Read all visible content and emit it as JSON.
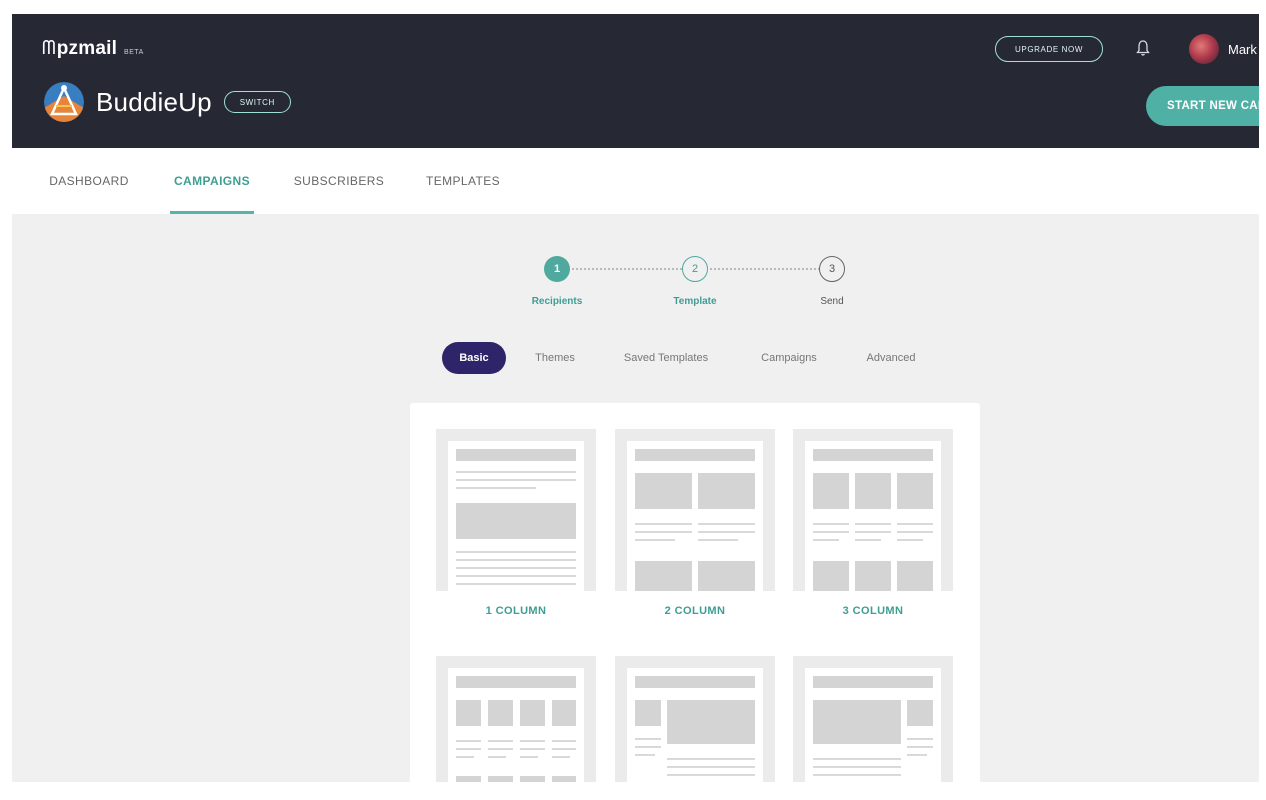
{
  "header": {
    "logo_text": "pzmail",
    "beta_label": "BETA",
    "upgrade_label": "UPGRADE NOW",
    "user_name": "Mark",
    "account_name": "BuddieUp",
    "switch_label": "SWITCH",
    "start_label": "START NEW CAMPAIGN"
  },
  "nav": {
    "items": [
      "DASHBOARD",
      "CAMPAIGNS",
      "SUBSCRIBERS",
      "TEMPLATES"
    ],
    "active": "CAMPAIGNS"
  },
  "stepper": {
    "steps": [
      {
        "number": "1",
        "label": "Recipients",
        "state": "complete"
      },
      {
        "number": "2",
        "label": "Template",
        "state": "current"
      },
      {
        "number": "3",
        "label": "Send",
        "state": "upcoming"
      }
    ]
  },
  "template_tabs": {
    "items": [
      "Basic",
      "Themes",
      "Saved Templates",
      "Campaigns",
      "Advanced"
    ],
    "active": "Basic"
  },
  "templates": [
    {
      "label": "1 COLUMN"
    },
    {
      "label": "2 COLUMN"
    },
    {
      "label": "3 COLUMN"
    },
    {
      "label": ""
    },
    {
      "label": ""
    },
    {
      "label": ""
    }
  ],
  "colors": {
    "header_bg": "#262834",
    "accent_teal": "#4fb0a6",
    "active_tab": "#2e2469",
    "page_bg": "#f0f0f0"
  },
  "icons": [
    "bell-icon",
    "avatar",
    "brand-logo-icon"
  ]
}
